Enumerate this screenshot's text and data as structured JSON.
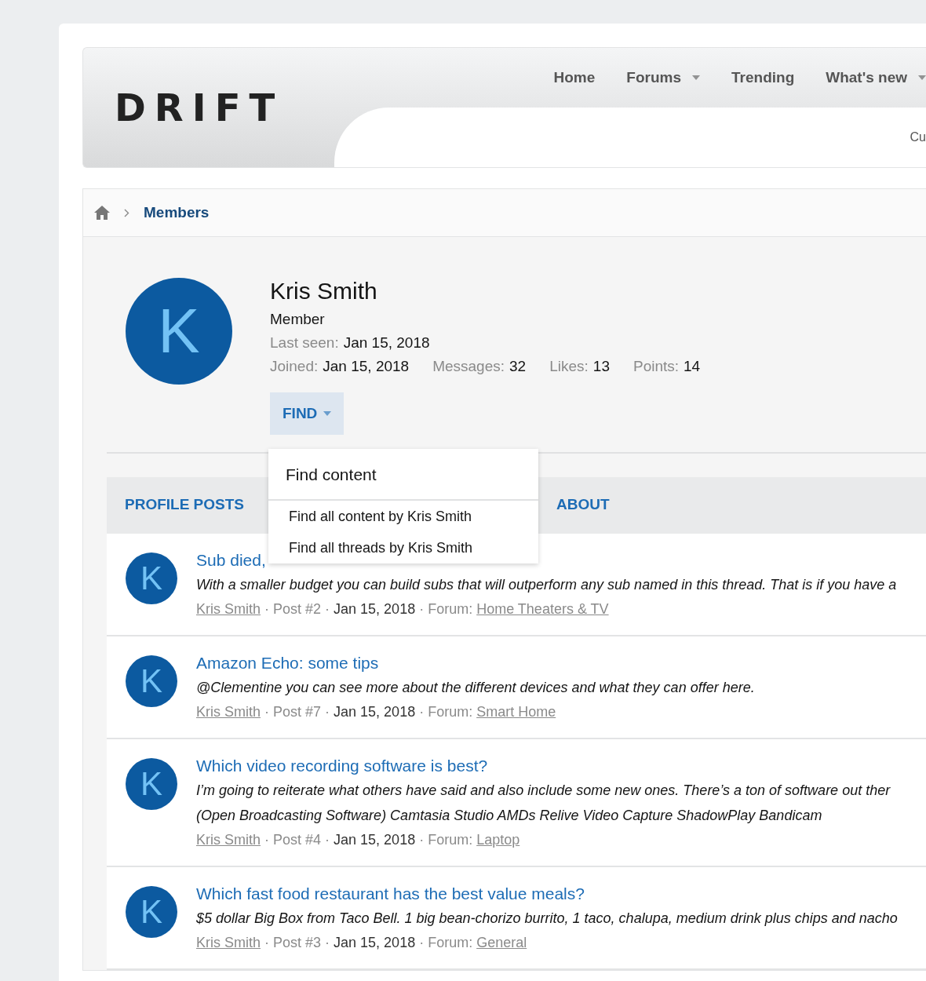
{
  "logo": "DRIFT",
  "nav": [
    {
      "label": "Home",
      "dropdown": false
    },
    {
      "label": "Forums",
      "dropdown": true
    },
    {
      "label": "Trending",
      "dropdown": false
    },
    {
      "label": "What's new",
      "dropdown": true
    }
  ],
  "subnav": [
    "Cu"
  ],
  "breadcrumb": [
    "Members"
  ],
  "profile": {
    "avatar": "K",
    "name": "Kris Smith",
    "title": "Member",
    "last_seen": {
      "label": "Last seen:",
      "value": "Jan 15, 2018"
    },
    "stats": [
      {
        "label": "Joined:",
        "value": "Jan 15, 2018"
      },
      {
        "label": "Messages:",
        "value": "32"
      },
      {
        "label": "Likes:",
        "value": "13"
      },
      {
        "label": "Points:",
        "value": "14"
      }
    ],
    "find_button": {
      "label": "FIND",
      "expanded": true
    }
  },
  "find_menu": {
    "header": "Find content",
    "items": [
      "Find all content by Kris Smith",
      "Find all threads by Kris Smith"
    ]
  },
  "tabs": [
    {
      "label": "PROFILE POSTS",
      "selected": false
    },
    {
      "label": "ABOUT",
      "selected": false
    }
  ],
  "separator": "·",
  "posts": [
    {
      "avatar": "K",
      "title": "Sub died,",
      "snippet": [
        "With a smaller budget you can build subs that will outperform any sub named in this thread. That is if you have a"
      ],
      "author": "Kris Smith",
      "post": "Post #2",
      "date": "Jan 15, 2018",
      "forum_label": "Forum:",
      "forum": "Home Theaters & TV"
    },
    {
      "avatar": "K",
      "title": "Amazon Echo: some tips",
      "snippet": [
        "@Clementine you can see more about the different devices and what they can offer here."
      ],
      "author": "Kris Smith",
      "post": "Post #7",
      "date": "Jan 15, 2018",
      "forum_label": "Forum:",
      "forum": "Smart Home"
    },
    {
      "avatar": "K",
      "title": "Which video recording software is best?",
      "snippet": [
        "I’m going to reiterate what others have said and also include some new ones. There’s a ton of software out ther",
        "(Open Broadcasting Software) Camtasia Studio AMDs Relive Video Capture ShadowPlay Bandicam"
      ],
      "author": "Kris Smith",
      "post": "Post #4",
      "date": "Jan 15, 2018",
      "forum_label": "Forum:",
      "forum": "Laptop"
    },
    {
      "avatar": "K",
      "title": "Which fast food restaurant has the best value meals?",
      "snippet": [
        "$5 dollar Big Box from Taco Bell. 1 big bean-chorizo burrito, 1 taco, chalupa, medium drink plus chips and nacho"
      ],
      "author": "Kris Smith",
      "post": "Post #3",
      "date": "Jan 15, 2018",
      "forum_label": "Forum:",
      "forum": "General"
    }
  ]
}
